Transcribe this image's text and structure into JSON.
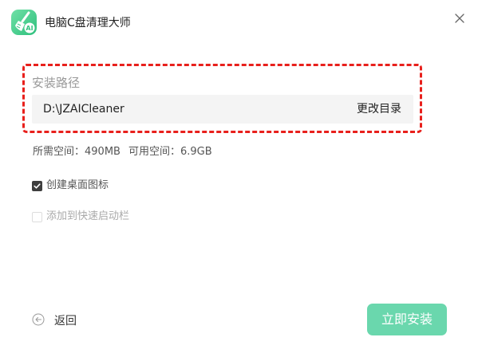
{
  "app": {
    "title": "电脑C盘清理大师",
    "logo_badge": "AI",
    "accent_color": "#3cc78a",
    "icon": "broom-logo-icon"
  },
  "window_controls": {
    "close_icon": "close-icon"
  },
  "install_path": {
    "label": "安装路径",
    "value": "D:\\JZAICleaner",
    "change_button": "更改目录",
    "highlight_color": "#e8201c"
  },
  "space": {
    "required_label": "所需空间：",
    "required_value": "490MB",
    "available_label": "可用空间：",
    "available_value": "6.9GB"
  },
  "options": [
    {
      "label": "创建桌面图标",
      "checked": true,
      "enabled": true
    },
    {
      "label": "添加到快速启动栏",
      "checked": false,
      "enabled": false
    }
  ],
  "footer": {
    "back_label": "返回",
    "back_icon": "back-arrow-icon",
    "install_label": "立即安装",
    "install_color": "#6ad7ad"
  }
}
